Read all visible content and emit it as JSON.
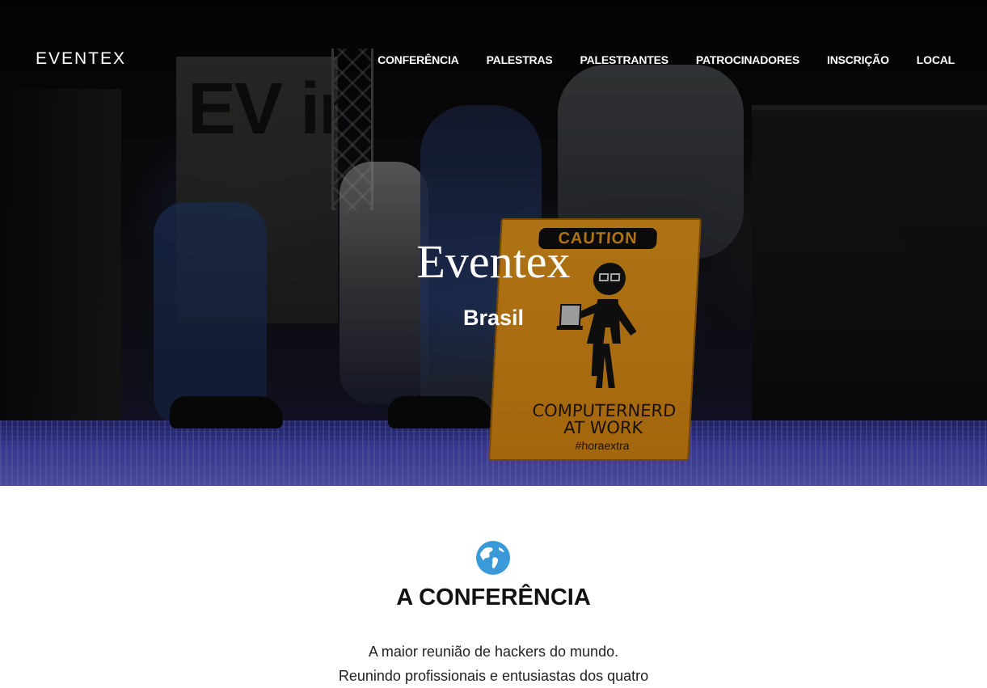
{
  "header": {
    "logo": "EVENTEX",
    "nav": [
      "CONFERÊNCIA",
      "PALESTRAS",
      "PALESTRANTES",
      "PATROCINADORES",
      "INSCRIÇÃO",
      "LOCAL"
    ]
  },
  "hero": {
    "title": "Eventex",
    "subtitle": "Brasil",
    "photo_sign": {
      "caution": "CAUTION",
      "line1": "COMPUTERNERD",
      "line2": "AT WORK",
      "hashtag": "#horaextra"
    },
    "banner_text": "EV in Rio"
  },
  "conference": {
    "icon": "globe-icon",
    "title": "A CONFERÊNCIA",
    "line1": "A maior reunião de hackers do mundo.",
    "line2": "Reunindo profissionais e entusiastas dos quatro"
  },
  "colors": {
    "globe": "#3a9ad9",
    "sign": "#f2a01e",
    "carpet": "#4a4ac0"
  }
}
